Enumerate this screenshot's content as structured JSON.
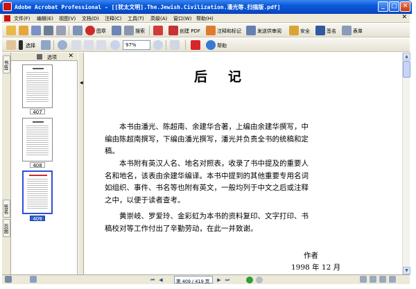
{
  "window": {
    "title": "Adobe Acrobat Professional - [[犹太文明].The.Jewish.Civilization.潘光等.扫描版.pdf]",
    "minimize_label": "_",
    "maximize_label": "□",
    "close_label": "✕"
  },
  "menubar": {
    "items": [
      "文件(F)",
      "编辑(E)",
      "视图(V)",
      "文档(D)",
      "注释(C)",
      "工具(T)",
      "高级(A)",
      "窗口(W)",
      "帮助(H)"
    ],
    "close_label": "✕"
  },
  "toolbar1": {
    "stamp_label": "图章",
    "search_label": "搜索",
    "create_pdf_label": "创建 PDF",
    "review_label": "注释和标记",
    "send_review_label": "发送供审阅",
    "security_label": "安全",
    "sign_label": "签名",
    "forms_label": "表单"
  },
  "toolbar2": {
    "select_label": "选择",
    "zoom_value": "97%",
    "help_label": "帮助"
  },
  "side_tabs": [
    "书签",
    "签名",
    "页面"
  ],
  "panel": {
    "options_label": "选项",
    "close_label": "✕",
    "thumbnails": [
      {
        "label": "407",
        "selected": false
      },
      {
        "label": "408",
        "selected": false
      },
      {
        "label": "409",
        "selected": true
      }
    ]
  },
  "document": {
    "heading": "后记",
    "paragraphs": [
      [
        "本书由潘光、陈超南、余建华合著，上编由余建华撰写，中",
        "编由陈超南撰写，下编由潘光撰写，潘光并负责全书的统稿和定",
        "稿。"
      ],
      [
        "本书附有英汉人名、地名对照表，收录了书中提及的重要人",
        "名和地名，该表由余建华编译。本书中提到的其他重要专用名词",
        "如组织、事件、书名等也附有英文，一般均列于中文之后或注释",
        "之中，以便于读者查考。"
      ],
      [
        "黄崇岐、罗爱玲、金彩虹为本书的资料复印、文字打印、书",
        "稿校对等工作付出了辛勤劳动，在此一并致谢。"
      ]
    ],
    "author": "作者",
    "date": "1998 年 12 月"
  },
  "statusbar": {
    "page_indicator": "第 409 / 419 页"
  }
}
